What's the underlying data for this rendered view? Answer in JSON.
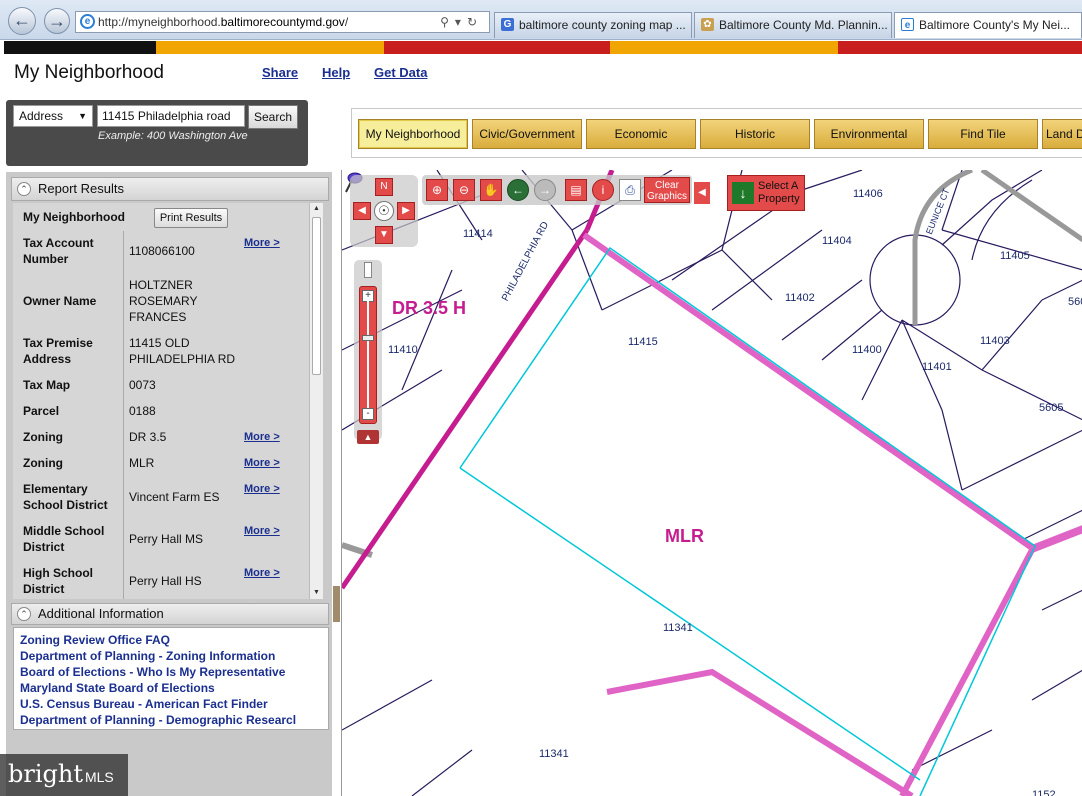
{
  "browser": {
    "url_prefix": "http://myneighborhood.",
    "url_host": "baltimorecountymd.gov",
    "url_suffix": "/",
    "tabs": [
      {
        "label": "baltimore county zoning map ...",
        "icon": "G"
      },
      {
        "label": "Baltimore County Md. Plannin...",
        "icon": "✿"
      },
      {
        "label": "Baltimore County's My Nei...",
        "icon": "e"
      }
    ]
  },
  "stripe_colors": [
    "#111111",
    "#f0a500",
    "#c81e1e",
    "#f0a500",
    "#c81e1e"
  ],
  "header": {
    "title": "My Neighborhood",
    "links": [
      "Share",
      "Help",
      "Get Data"
    ]
  },
  "search": {
    "type": "Address",
    "value": "11415 Philadelphia road",
    "button": "Search",
    "example": "Example: 400 Washington Ave"
  },
  "category_tabs": [
    "My Neighborhood",
    "Civic/Government",
    "Economic",
    "Historic",
    "Environmental",
    "Find Tile",
    "Land D"
  ],
  "report": {
    "heading": "Report Results",
    "section": "My Neighborhood",
    "print_button": "Print Results",
    "more_label": "More >",
    "rows": [
      {
        "label": "Tax Account Number",
        "value": "1108066100",
        "more": true
      },
      {
        "label": "Owner Name",
        "value": "HOLTZNER ROSEMARY FRANCES",
        "more": false
      },
      {
        "label": "Tax Premise Address",
        "value": "11415 OLD PHILADELPHIA RD",
        "more": false
      },
      {
        "label": "Tax Map",
        "value": "0073",
        "more": false
      },
      {
        "label": "Parcel",
        "value": "0188",
        "more": false
      },
      {
        "label": "Zoning",
        "value": "DR 3.5",
        "more": true
      },
      {
        "label": "Zoning",
        "value": "MLR",
        "more": true
      },
      {
        "label": "Elementary School District",
        "value": "Vincent Farm ES",
        "more": true
      },
      {
        "label": "Middle School District",
        "value": "Perry Hall MS",
        "more": true
      },
      {
        "label": "High School District",
        "value": "Perry Hall HS",
        "more": true
      }
    ]
  },
  "additional": {
    "heading": "Additional Information",
    "links": [
      "Zoning Review Office FAQ",
      "Department of Planning - Zoning Information",
      "Board of Elections - Who Is My Representative",
      "Maryland State Board of Elections",
      "U.S. Census Bureau - American Fact Finder",
      "Department of Planning - Demographic Researcl"
    ]
  },
  "map": {
    "tools": {
      "clear": "Clear Graphics",
      "select": "Select A Property",
      "north": "N"
    },
    "zones": [
      "DR 3.5 H",
      "MLR"
    ],
    "road_labels": [
      "PHILADELPHIA RD",
      "EUNICE CT"
    ],
    "parcels": [
      "11406",
      "11414",
      "11404",
      "11405",
      "11402",
      "560",
      "11415",
      "11410",
      "11400",
      "11403",
      "11401",
      "5605",
      "11341",
      "11341",
      "1152"
    ]
  },
  "watermark": {
    "brand": "bright",
    "suffix": "MLS"
  }
}
